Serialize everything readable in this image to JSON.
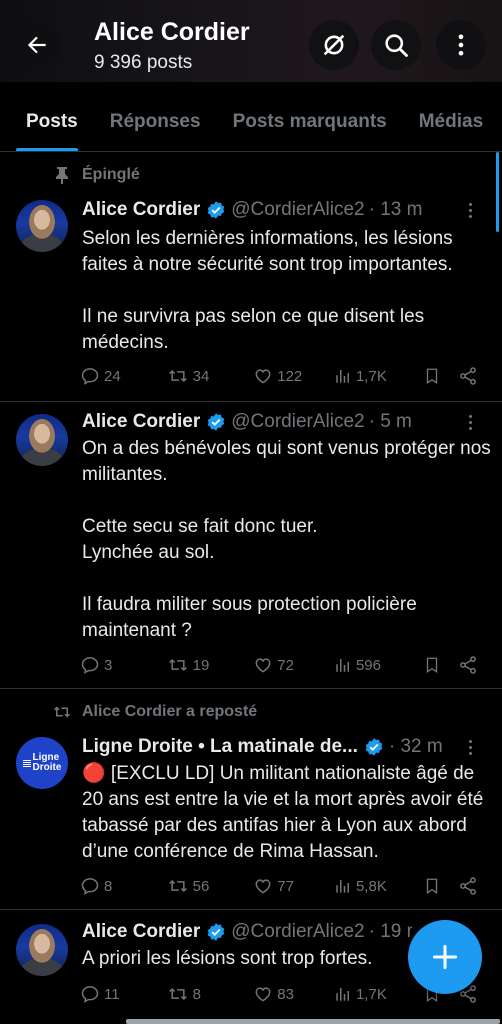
{
  "header": {
    "title": "Alice Cordier",
    "subtitle": "9 396 posts",
    "back_icon": "arrow-left-icon",
    "grok_icon": "grok-icon",
    "search_icon": "search-icon",
    "more_icon": "more-vertical-icon"
  },
  "tabs": [
    {
      "label": "Posts",
      "active": true
    },
    {
      "label": "Réponses",
      "active": false
    },
    {
      "label": "Posts marquants",
      "active": false
    },
    {
      "label": "Médias",
      "active": false
    }
  ],
  "posts": [
    {
      "context": "Épinglé",
      "context_icon": "pin-icon",
      "name": "Alice Cordier",
      "handle": "@CordierAlice2",
      "time": "· 13 m",
      "text": "Selon les dernières informations, les lésions faites à notre sécurité sont trop importantes.\n\nIl ne survivra pas selon ce que disent les médecins.",
      "replies": "24",
      "reposts": "34",
      "likes": "122",
      "views": "1,7K"
    },
    {
      "name": "Alice Cordier",
      "handle": "@CordierAlice2",
      "time": "· 5 m",
      "text": "On a des bénévoles qui sont venus protéger nos militantes.\n\nCette secu se fait donc tuer.\nLynchée au sol.\n\nIl faudra militer sous protection policière maintenant ?",
      "replies": "3",
      "reposts": "19",
      "likes": "72",
      "views": "596"
    },
    {
      "context": "Alice Cordier a reposté",
      "context_icon": "repost-icon",
      "name": "Ligne Droite • La matinale de...",
      "handle": "",
      "time": "· 32 m",
      "avatar_text_1": "Ligne",
      "avatar_text_2": "Droite",
      "text": "🔴 [EXCLU LD] Un militant nationaliste âgé de 20 ans est entre la vie et la mort après avoir été tabassé par des antifas hier à Lyon aux abord d’une conférence de Rima Hassan.",
      "replies": "8",
      "reposts": "56",
      "likes": "77",
      "views": "5,8K"
    },
    {
      "name": "Alice Cordier",
      "handle": "@CordierAlice2",
      "time": "· 19 m",
      "text": "A priori les lésions sont trop fortes.",
      "replies": "11",
      "reposts": "8",
      "likes": "83",
      "views": "1,7K"
    }
  ],
  "fab": {
    "icon": "plus-icon"
  },
  "colors": {
    "accent": "#1d9bf0",
    "muted": "#71767b",
    "text": "#e7e9ea",
    "background": "#000000"
  }
}
